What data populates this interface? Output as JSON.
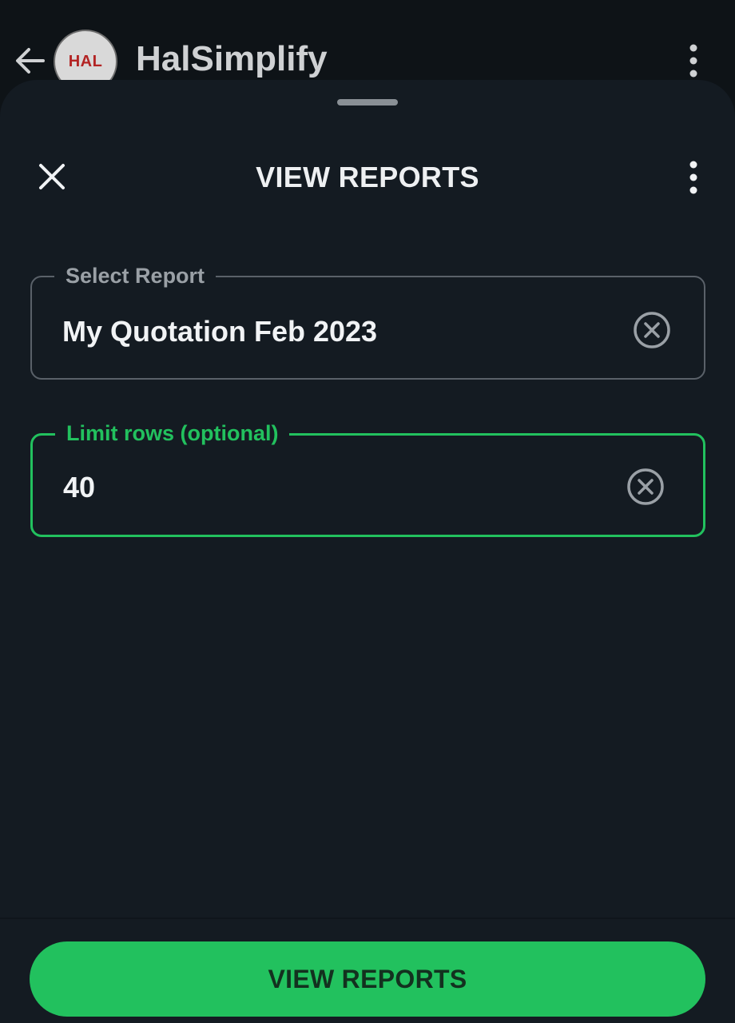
{
  "app_header": {
    "title": "HalSimplify",
    "avatar_text": "HAL",
    "back_icon": "back-arrow-icon",
    "menu_icon": "more-vertical-icon"
  },
  "sheet": {
    "title": "VIEW REPORTS",
    "close_icon": "close-icon",
    "menu_icon": "more-vertical-icon"
  },
  "fields": {
    "report": {
      "label": "Select Report",
      "value": "My Quotation Feb 2023",
      "clear_icon": "clear-circle-icon"
    },
    "limit_rows": {
      "label": "Limit rows  (optional)",
      "value": "40",
      "clear_icon": "clear-circle-icon",
      "focused": true
    }
  },
  "primary_button": {
    "label": "VIEW REPORTS"
  },
  "colors": {
    "accent": "#22c15e",
    "sheet_background": "#141b22",
    "background": "#0b0f13",
    "text_primary": "#f1f3f5",
    "text_secondary": "#9aa0a6",
    "avatar_text": "#b32424"
  }
}
